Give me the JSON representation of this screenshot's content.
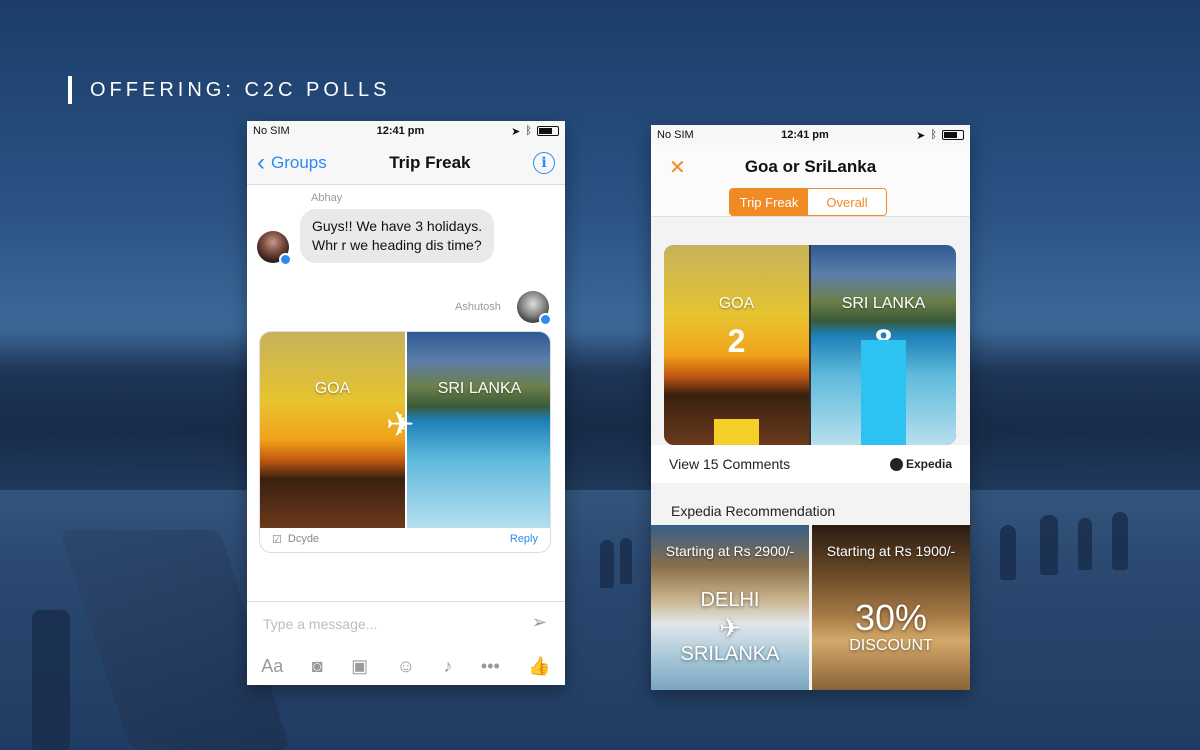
{
  "slide": {
    "title": "OFFERING: C2C POLLS"
  },
  "chat": {
    "status": {
      "carrier": "No SIM",
      "time": "12:41 pm"
    },
    "nav": {
      "back_label": "Groups",
      "title": "Trip Freak",
      "info_glyph": "i"
    },
    "messages": [
      {
        "sender": "Abhay",
        "text_line1": "Guys!! We have 3 holidays.",
        "text_line2": "Whr r we heading dis time?"
      },
      {
        "sender": "Ashutosh"
      }
    ],
    "poll_card": {
      "options": [
        "GOA",
        "SRI LANKA"
      ],
      "decide_label": "Dcyde",
      "reply_label": "Reply"
    },
    "composer": {
      "placeholder": "Type a message...",
      "aa_label": "Aa",
      "more_label": "•••"
    }
  },
  "results": {
    "status": {
      "carrier": "No SIM",
      "time": "12:41 pm"
    },
    "title": "Goa or SriLanka",
    "close_glyph": "✕",
    "tabs": [
      {
        "label": "Trip Freak",
        "active": true
      },
      {
        "label": "Overall",
        "active": false
      }
    ],
    "poll": [
      {
        "label": "GOA",
        "votes": 2,
        "bar_color": "#f5cf2a"
      },
      {
        "label": "SRI LANKA",
        "votes": 8,
        "bar_color": "#2cc3f3"
      }
    ],
    "comments_label": "View 15 Comments",
    "brand": "Expedia",
    "recommendation_title": "Expedia Recommendation",
    "deals": [
      {
        "price": "Starting at Rs 2900/-",
        "from": "DELHI",
        "to": "SRILANKA"
      },
      {
        "price": "Starting at Rs 1900/-",
        "big": "30%",
        "sub": "DISCOUNT"
      }
    ]
  },
  "colors": {
    "accent_blue": "#2d8af0",
    "accent_orange": "#f08a24"
  }
}
